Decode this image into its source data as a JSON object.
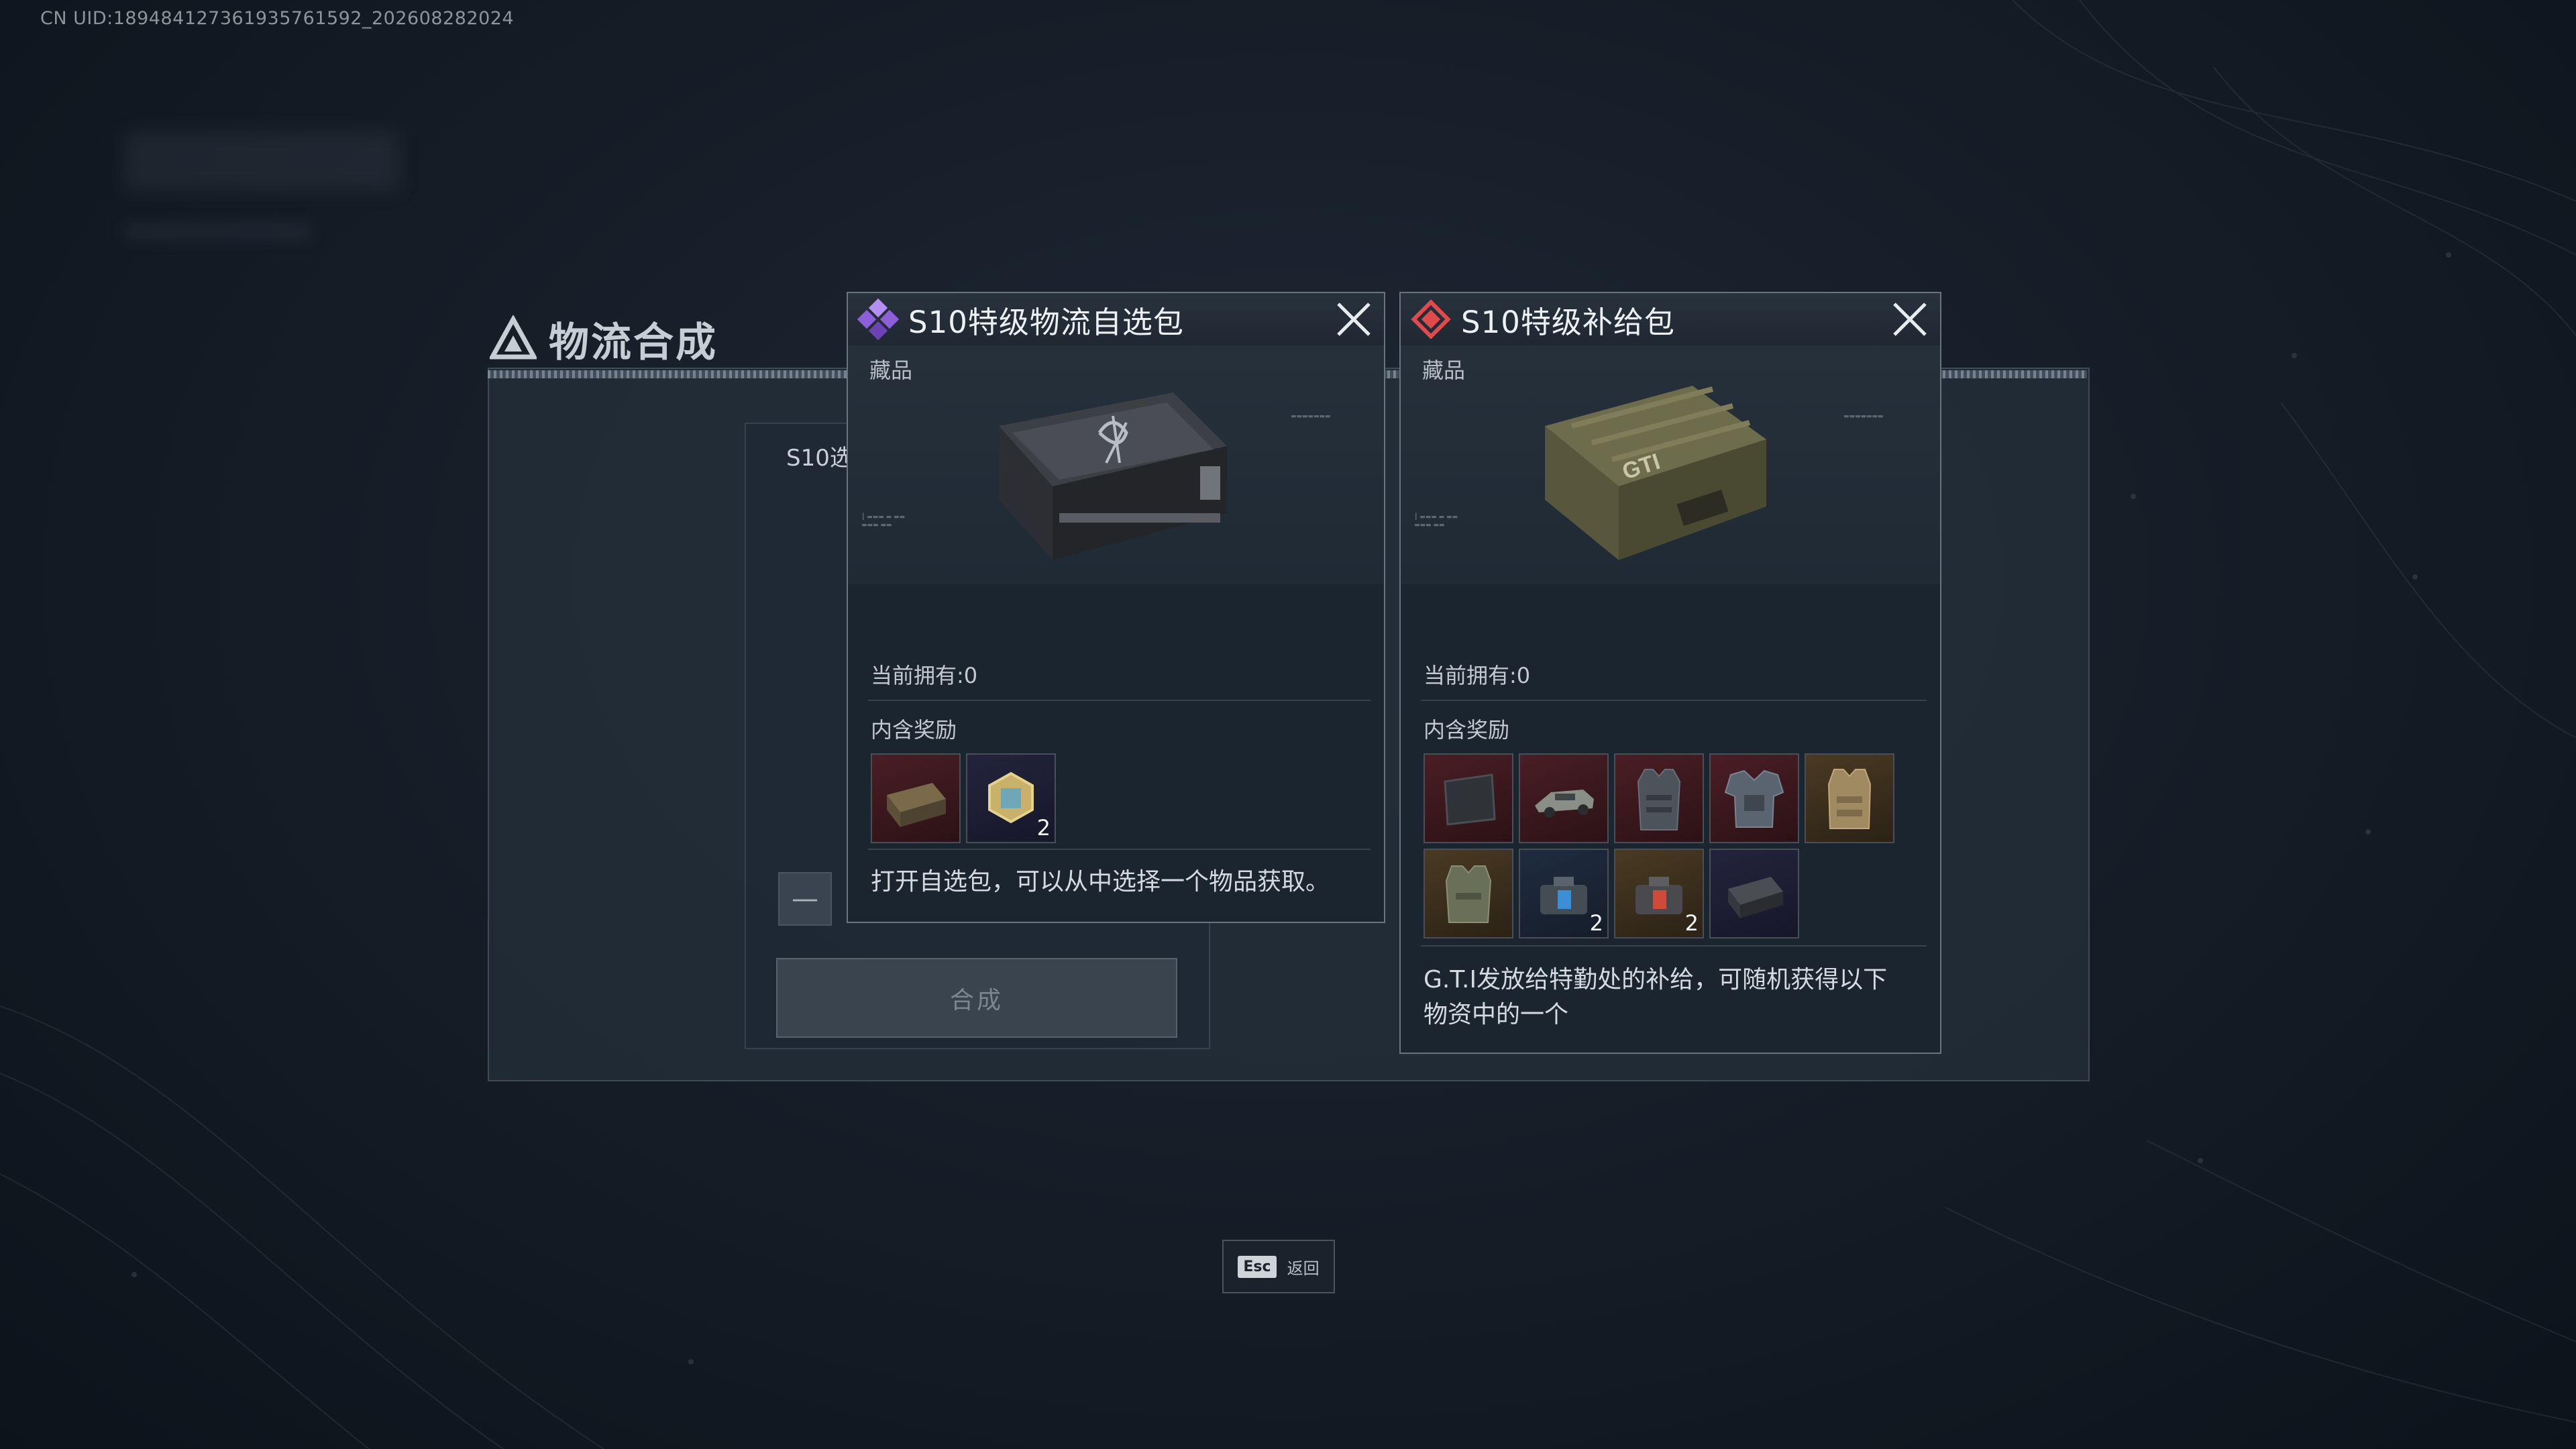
{
  "uid_text": "CN UID:18948412736193576159​2_202608282024",
  "main": {
    "title": "物流合成",
    "inner_label": "S10选",
    "minus_label": "—",
    "compose_label": "合成"
  },
  "popup_left": {
    "title": "S10特级物流自选包",
    "collection_label": "藏品",
    "owned_text": "当前拥有:0",
    "rewards_label": "内含奖励",
    "rewards": [
      {
        "icon": "supply-crate-icon",
        "rarity": "red",
        "count": ""
      },
      {
        "icon": "hex-token-icon",
        "rarity": "purple",
        "count": "2"
      }
    ],
    "description": "打开自选包，可以从中选择一个物品获取。",
    "gem_color": "#9b6fe0"
  },
  "popup_right": {
    "title": "S10特级补给包",
    "collection_label": "藏品",
    "owned_text": "当前拥有:0",
    "rewards_label": "内含奖励",
    "rewards": [
      {
        "icon": "armor-plate-icon",
        "rarity": "red",
        "count": ""
      },
      {
        "icon": "vehicle-icon",
        "rarity": "red",
        "count": ""
      },
      {
        "icon": "body-armor-icon",
        "rarity": "red",
        "count": ""
      },
      {
        "icon": "tactical-vest-icon",
        "rarity": "red",
        "count": ""
      },
      {
        "icon": "tan-vest-icon",
        "rarity": "gold",
        "count": ""
      },
      {
        "icon": "olive-vest-icon",
        "rarity": "gold",
        "count": ""
      },
      {
        "icon": "blue-kit-icon",
        "rarity": "blue",
        "count": "2"
      },
      {
        "icon": "red-kit-icon",
        "rarity": "gold",
        "count": "2"
      },
      {
        "icon": "black-case-icon",
        "rarity": "purple",
        "count": ""
      }
    ],
    "description_line1": "G.T.I发放给特勤处的补给，可随机获得以下",
    "description_line2": "物资中的一个",
    "gem_color": "#e04a4a"
  },
  "esc": {
    "key": "Esc",
    "label": "返回"
  }
}
